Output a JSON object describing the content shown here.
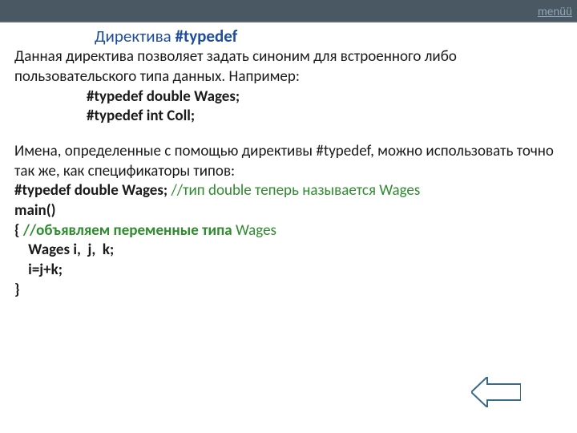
{
  "header": {
    "menu_label": "menüü"
  },
  "title": {
    "part1": "Директива ",
    "part2": "#typedef"
  },
  "body": {
    "p1": "Данная директива позволяет задать синоним для встроенного либо пользовательского типа данных. Например:",
    "code1": "#typedef double Wages;",
    "code2": "#typedef  int Coll;",
    "p2": "Имена, определенные с помощью директивы #typedef, можно использовать точно так же, как спецификаторы типов:",
    "line1_code": "#typedef   double   Wages;",
    "line1_comment": "  //тип  double теперь называется Wages",
    "main_sig": "main()",
    "brace_open": "{",
    "comment_vars": "    //объявляем переменные типа ",
    "comment_vars_tail": "Wages",
    "decl": "    Wages i,  j,  k;",
    "assign": "    i=j+k;",
    "brace_close": "}"
  },
  "icons": {
    "back": "back-arrow-icon"
  },
  "colors": {
    "header_bg": "#4a5863",
    "title_blue": "#1f4e9c",
    "comment_green": "#2e8b2e"
  }
}
